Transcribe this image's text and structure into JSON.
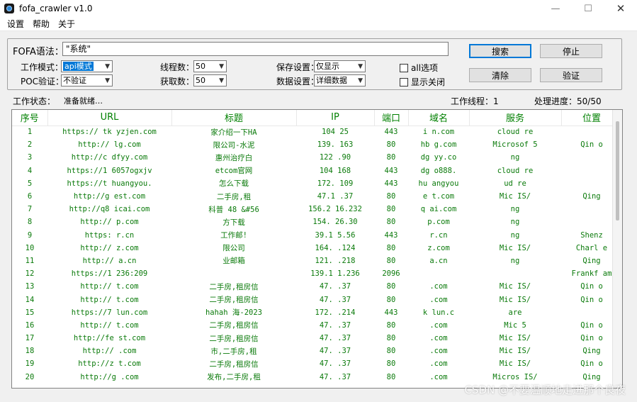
{
  "window": {
    "title": "fofa_crawler v1.0",
    "minimize": "—",
    "maximize": "☐",
    "close": "✕"
  },
  "menu": [
    "设置",
    "帮助",
    "关于"
  ],
  "search": {
    "label": "FOFA语法：",
    "value": "\"系统\""
  },
  "options": {
    "work_mode_label": "工作模式：",
    "work_mode_value": "api模式",
    "poc_label": "POC验证：",
    "poc_value": "不验证",
    "threads_label": "线程数：",
    "threads_value": "50",
    "fetch_label": "获取数：",
    "fetch_value": "50",
    "save_label": "保存设置：",
    "save_value": "仅显示",
    "data_label": "数据设置：",
    "data_value": "详细数据",
    "all_label": "all选项",
    "show_close_label": "显示关闭"
  },
  "buttons": {
    "search": "搜索",
    "stop": "停止",
    "clear": "清除",
    "verify": "验证"
  },
  "status": {
    "state_label": "工作状态：",
    "state_value": "准备就绪…",
    "threads_text": "工作线程：1",
    "progress_text": "处理进度：50/50"
  },
  "table": {
    "columns": [
      "序号",
      "URL",
      "标题",
      "IP",
      "端口",
      "域名",
      "服务",
      "位置"
    ],
    "rows": [
      [
        "1",
        "https://    tk    yzjen.com",
        "    家介绍一下HA",
        "104     25",
        "443",
        "i    n.com",
        "cloud    re",
        ""
      ],
      [
        "2",
        "http://    lg.com",
        "    限公司-水泥",
        "139.    163",
        "80",
        "hb    g.com",
        "Microsof    5",
        "Qin    o"
      ],
      [
        "3",
        "http://c    dfyy.com",
        "    惠州治疗白",
        "122    .90",
        "80",
        "dg    yy.co",
        "ng    ",
        ""
      ],
      [
        "4",
        "https://1    6057ogxjv",
        "    etcom官网",
        "104    168",
        "443",
        "dg    o888.",
        "cloud    re",
        ""
      ],
      [
        "5",
        "https://t    huangyou.",
        "    怎么下载",
        "172.    109",
        "443",
        "hu    angyou",
        "    ud    re",
        ""
      ],
      [
        "6",
        "http://g    est.com",
        "    二手房,租",
        "47.1    .37",
        "80",
        "e    t.com",
        "Mic    IS/",
        "Qing    "
      ],
      [
        "7",
        "http://q8    icai.com",
        "科普    48    &#56",
        "156.2    16.232",
        "80",
        "q    ai.com",
        "ng    ",
        ""
      ],
      [
        "8",
        "http://    p.com",
        "    方下载",
        "154.    26.30",
        "80",
        "    p.com",
        "ng    ",
        ""
      ],
      [
        "9",
        "https:    r.cn",
        "    工作邮!",
        "39.1    5.56",
        "443",
        "    r.cn",
        "ng    ",
        "Shenz    "
      ],
      [
        "10",
        "http://    z.com",
        "    限公司",
        "164.    .124",
        "80",
        "    z.com",
        "Mic    IS/",
        "Charl    e"
      ],
      [
        "11",
        "http://    a.cn",
        "    业邮箱",
        "121.    .218",
        "80",
        "    a.cn",
        "ng    ",
        "Qing    "
      ],
      [
        "12",
        "https://1    236:209",
        "    ",
        "139.1    1.236",
        "2096",
        "",
        "",
        "Frankf    am"
      ],
      [
        "13",
        "http://    t.com",
        "    二手房,租房信",
        "47.    .37",
        "80",
        "    .com",
        "Mic    IS/",
        "Qin    o"
      ],
      [
        "14",
        "http://    t.com",
        "    二手房,租房信",
        "47.    .37",
        "80",
        "    .com",
        "Mic    IS/",
        "Qin    o"
      ],
      [
        "15",
        "https://7    lun.com",
        "hahah    海-2023",
        "172.    .214",
        "443",
        "k    lun.c",
        "    are",
        ""
      ],
      [
        "16",
        "http://    t.com",
        "    二手房,租房信",
        "47.    .37",
        "80",
        "    .com",
        "Mic    5",
        "Qin    o"
      ],
      [
        "17",
        "http://fe    st.com",
        "    二手房,租房信",
        "47.    .37",
        "80",
        "    .com",
        "Mic    IS/",
        "Qin    o"
      ],
      [
        "18",
        "http://    .com",
        "    市,二手房,租",
        "47.    .37",
        "80",
        "    .com",
        "Mic    IS/",
        "Qing    "
      ],
      [
        "19",
        "http://z    t.com",
        "    二手房,租房信",
        "47.    .37",
        "80",
        "    .com",
        "Mic    IS/",
        "Qin    o"
      ],
      [
        "20",
        "http://g    .com",
        "    发布,二手房,租",
        "47.    .37",
        "80",
        "    .com",
        "Micros    IS/",
        "Qing    "
      ]
    ]
  },
  "watermark": "CSDN @不要温顺地走进那个良夜"
}
